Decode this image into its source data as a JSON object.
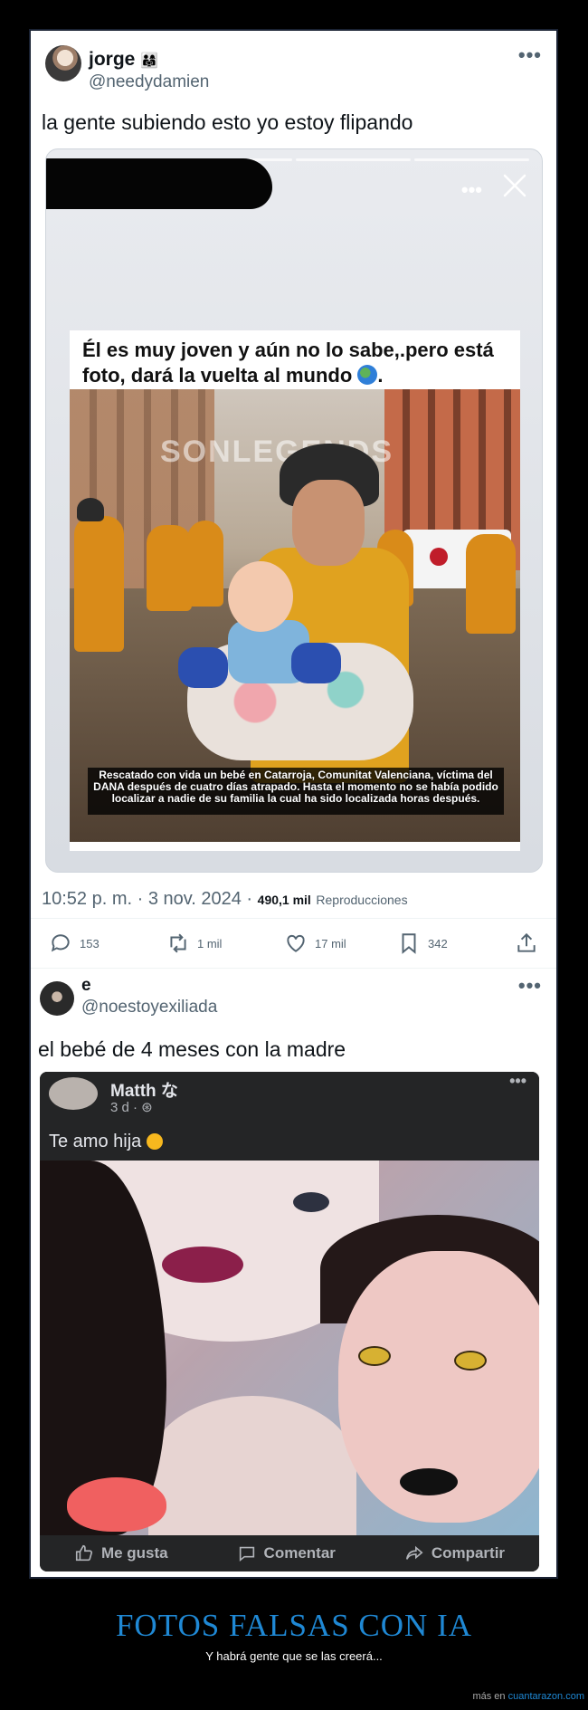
{
  "tweet1": {
    "name": "jorge",
    "name_emoji": "👨‍👩‍👧",
    "handle": "@needydamien",
    "more": "•••",
    "text": "la gente subiendo esto yo estoy flipando",
    "media": {
      "story_dots": "•••",
      "post_caption": "Él es muy joven y aún no lo sabe,.pero está foto, dará la vuelta al mundo",
      "watermark": "SONLEGENDS",
      "photo_caption": "Rescatado con vida un bebé en Catarroja, Comunitat Valenciana, víctima del DANA después de cuatro días atrapado. Hasta el momento no se había podido localizar a nadie de su familia la cual ha sido localizada horas después."
    },
    "time": "10:52 p. m. · 3 nov. 2024 ·",
    "views": "490,1 mil",
    "views_label": "Reproducciones",
    "replies": "153",
    "retweets": "1 mil",
    "likes": "17 mil",
    "bookmarks": "342"
  },
  "tweet2": {
    "name": "e",
    "handle": "@noestoyexiliada",
    "more": "•••",
    "text": "el bebé de 4 meses con la madre",
    "fb": {
      "name": "Matth な",
      "time": "3 d · ⊛",
      "more": "•••",
      "text": "Te amo hija",
      "like": "Me gusta",
      "comment": "Comentar",
      "share": "Compartir"
    }
  },
  "meme": {
    "title": "FOTOS FALSAS CON IA",
    "subtitle": "Y habrá gente que se las creerá...",
    "footer_prefix": "más en",
    "footer_link": "cuantarazon.com"
  },
  "colors": {
    "title_blue": "#1f88d4",
    "frame_border": "#1a2233"
  }
}
